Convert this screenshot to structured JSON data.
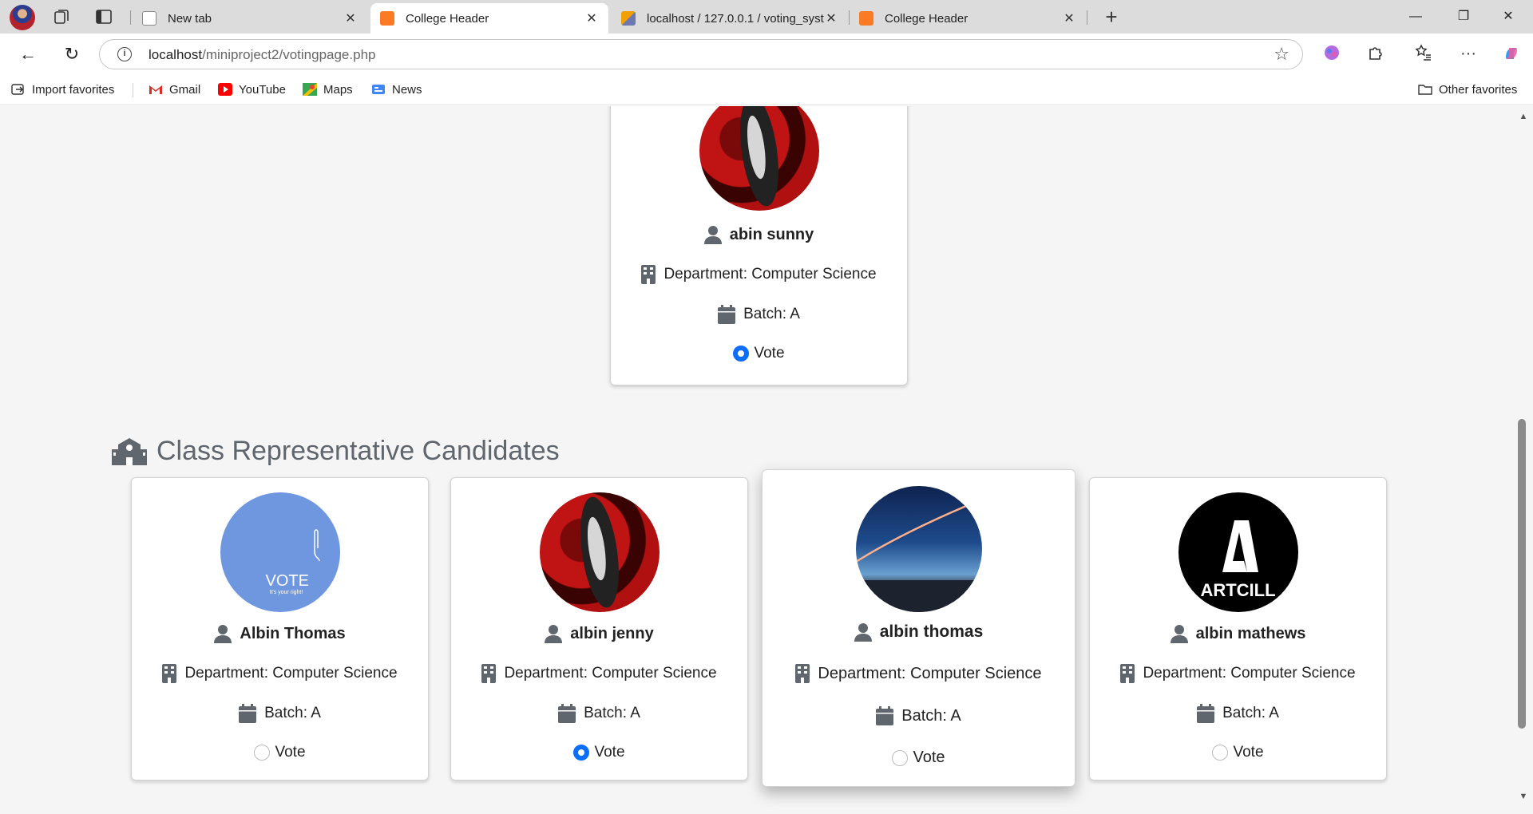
{
  "browser": {
    "tabs": [
      {
        "title": "New tab",
        "favicon": "page-icon"
      },
      {
        "title": "College Header",
        "favicon": "xampp-icon"
      },
      {
        "title": "localhost / 127.0.0.1 / voting_syst",
        "favicon": "phpmyadmin-icon"
      },
      {
        "title": "College Header",
        "favicon": "xampp-icon"
      }
    ],
    "url_host": "localhost",
    "url_path": "/miniproject2/votingpage.php",
    "bookmarks": [
      "Import favorites",
      "Gmail",
      "YouTube",
      "Maps",
      "News"
    ],
    "other_favorites": "Other favorites"
  },
  "top_candidate": {
    "name": "abin sunny",
    "department": "Department: Computer Science",
    "batch": "Batch: A",
    "vote_label": "Vote",
    "selected": true,
    "avatar": "deadpool-avatar"
  },
  "section": {
    "title": "Class Representative Candidates",
    "icon": "school-icon"
  },
  "candidates": [
    {
      "name": "Albin Thomas",
      "department": "Department: Computer Science",
      "batch": "Batch: A",
      "vote_label": "Vote",
      "selected": false,
      "avatar": "vote-avatar"
    },
    {
      "name": "albin jenny",
      "department": "Department: Computer Science",
      "batch": "Batch: A",
      "vote_label": "Vote",
      "selected": true,
      "avatar": "deadpool-avatar"
    },
    {
      "name": "albin thomas",
      "department": "Department: Computer Science",
      "batch": "Batch: A",
      "vote_label": "Vote",
      "selected": false,
      "avatar": "night-sky-avatar"
    },
    {
      "name": "albin mathews",
      "department": "Department: Computer Science",
      "batch": "Batch: A",
      "vote_label": "Vote",
      "selected": false,
      "avatar": "artcill-logo-avatar"
    }
  ],
  "avatar_text": {
    "vote": "VOTE",
    "vote_sub": "It's your right!",
    "artcill": "ARTCILL"
  },
  "colors": {
    "accent": "#0d6efd",
    "icon_gray": "#5f666d",
    "page_bg": "#f5f5f5"
  }
}
